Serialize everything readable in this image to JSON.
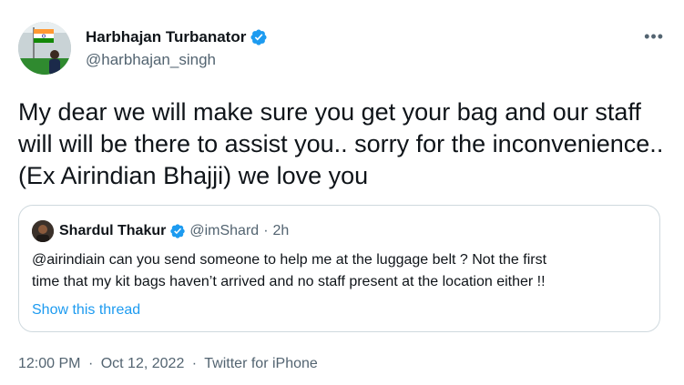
{
  "author": {
    "display_name": "Harbhajan Turbanator",
    "handle": "@harbhajan_singh",
    "verified": true,
    "avatar_icon": "avatar-indian-flag"
  },
  "more_icon": "•••",
  "tweet": {
    "text": "My dear we will make sure you get your bag and our staff will will be there to assist you.. sorry for the inconvenience.. (Ex Airindian Bhajji) we love you"
  },
  "quoted": {
    "display_name": "Shardul Thakur",
    "handle": "@imShard",
    "separator": "·",
    "time": "2h",
    "verified": true,
    "text_line1": "@airindiain can you send someone to help me at the luggage belt ? Not the first",
    "text_line2": "time that my kit bags haven’t arrived and no staff present at the location either !!",
    "show_thread": "Show this thread"
  },
  "meta": {
    "time": "12:00 PM",
    "separator": "·",
    "date": "Oct 12, 2022",
    "source": "Twitter for iPhone"
  },
  "colors": {
    "text": "#0f1419",
    "secondary": "#536471",
    "accent": "#1d9bf0",
    "border": "#cfd9de"
  }
}
